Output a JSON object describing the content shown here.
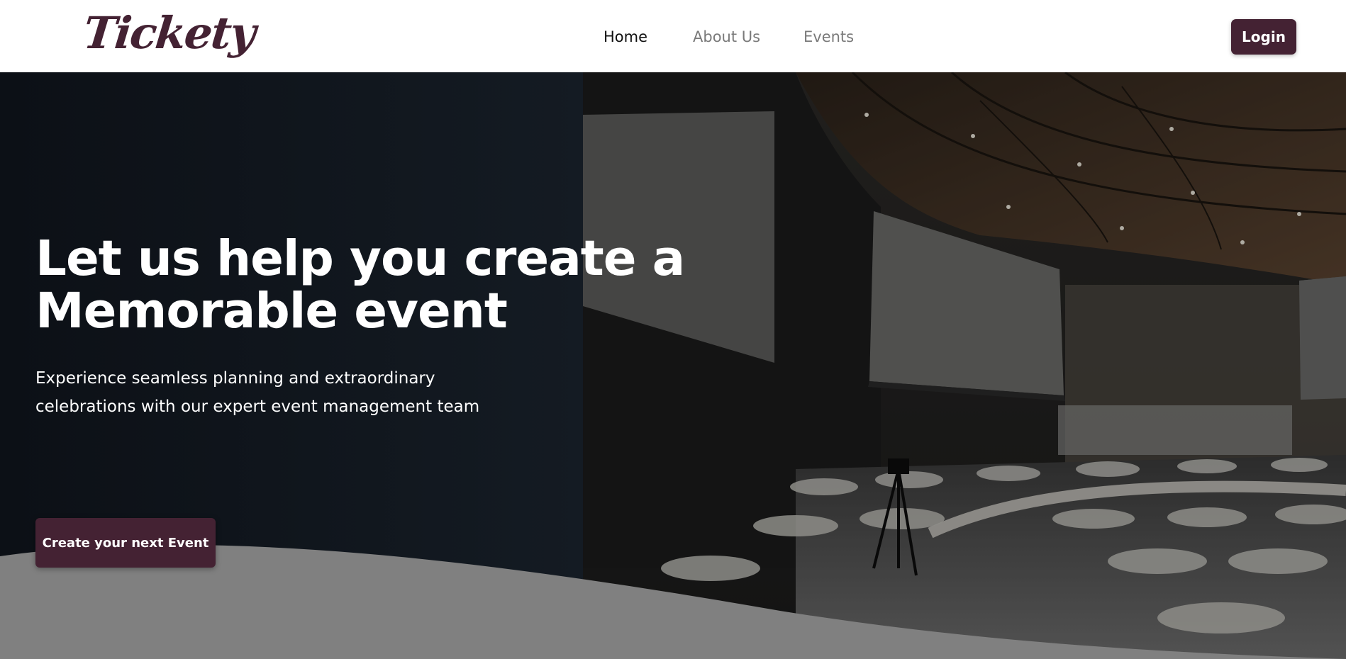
{
  "header": {
    "logo_text": "Tickety",
    "nav": [
      {
        "label": "Home",
        "active": true
      },
      {
        "label": "About Us",
        "active": false
      },
      {
        "label": "Events",
        "active": false
      }
    ],
    "login_label": "Login"
  },
  "hero": {
    "headline_line1": "Let us help you create a",
    "headline_line2": "Memorable event",
    "subtext_line1": "Experience seamless planning and extraordinary",
    "subtext_line2": "celebrations with our expert event management team",
    "cta_label": "Create your next Event",
    "background_image": "conference-hall-photo"
  },
  "colors": {
    "brand": "#442233",
    "hero_dark": "#121820",
    "wave": "#808080",
    "nav_active": "#111111",
    "nav_inactive": "#7a7a7a"
  }
}
